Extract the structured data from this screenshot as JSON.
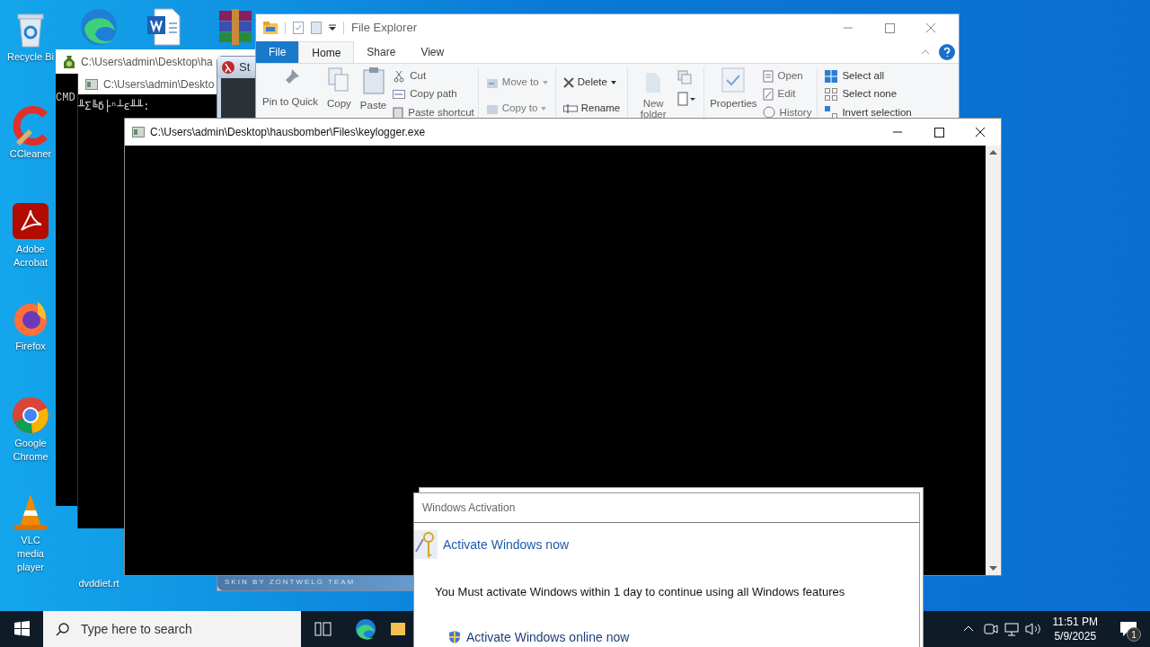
{
  "desktop_icons": [
    {
      "label": "Recycle Bi",
      "kind": "recycle"
    },
    {
      "kind": "edge"
    },
    {
      "kind": "word"
    },
    {
      "kind": "winrar"
    },
    {
      "label": "CCleaner",
      "kind": "ccleaner"
    },
    {
      "label": "Adobe Acrobat",
      "kind": "acrobat"
    },
    {
      "label": "Firefox",
      "kind": "firefox"
    },
    {
      "label": "Google Chrome",
      "kind": "chrome"
    },
    {
      "label": "VLC media player",
      "kind": "vlc"
    },
    {
      "label": "dvddiet.rt",
      "kind": "file"
    }
  ],
  "console_back": {
    "title": "C:\\Users\\admin\\Desktop\\ha",
    "text": "CMD"
  },
  "console_middle": {
    "title": "C:\\Users\\admin\\Deskto",
    "text": "╨Σ╚δ├ⁿ┴ε╨╨:"
  },
  "skinned_window": {
    "title": "St",
    "footer": "SKIN BY ZONTWELG TEAM"
  },
  "file_explorer": {
    "title": "File Explorer",
    "tabs": [
      {
        "label": "File",
        "selected": false,
        "kind": "file"
      },
      {
        "label": "Home",
        "selected": true,
        "kind": "tab"
      },
      {
        "label": "Share",
        "selected": false,
        "kind": "tab"
      },
      {
        "label": "View",
        "selected": false,
        "kind": "tab"
      }
    ],
    "clipboard": {
      "large": [
        {
          "label": "Pin to Quick",
          "kind": "pin"
        },
        {
          "label": "Copy",
          "kind": "copy"
        },
        {
          "label": "Paste",
          "kind": "paste"
        }
      ],
      "small": [
        {
          "label": "Cut",
          "kind": "cut"
        },
        {
          "label": "Copy path",
          "kind": "path"
        },
        {
          "label": "Paste shortcut",
          "kind": "shortcut"
        }
      ]
    },
    "organize": [
      {
        "label": "Move to",
        "kind": "move",
        "dropdown": true
      },
      {
        "label": "Copy to",
        "kind": "copyto",
        "dropdown": true
      },
      {
        "label": "Delete",
        "kind": "delete",
        "dropdown": true
      },
      {
        "label": "Rename",
        "kind": "rename",
        "dropdown": false
      }
    ],
    "new_folder": "New folder",
    "properties": "Properties",
    "open": [
      {
        "label": "Open",
        "kind": "open"
      },
      {
        "label": "Edit",
        "kind": "edit"
      },
      {
        "label": "History",
        "kind": "history"
      }
    ],
    "select": [
      {
        "label": "Select all",
        "kind": "all"
      },
      {
        "label": "Select none",
        "kind": "none"
      },
      {
        "label": "Invert selection",
        "kind": "invert"
      }
    ]
  },
  "console_front": {
    "title": "C:\\Users\\admin\\Desktop\\hausbomber\\Files\\keylogger.exe"
  },
  "activation_dialog": {
    "title": "Windows Activation",
    "heading": "Activate Windows now",
    "message": "You Must activate Windows within 1 day to continue using all Windows features",
    "link": "Activate Windows online now"
  },
  "taskbar": {
    "search_placeholder": "Type here to search",
    "time": "11:51 PM",
    "date": "5/9/2025",
    "notifications": "1"
  }
}
